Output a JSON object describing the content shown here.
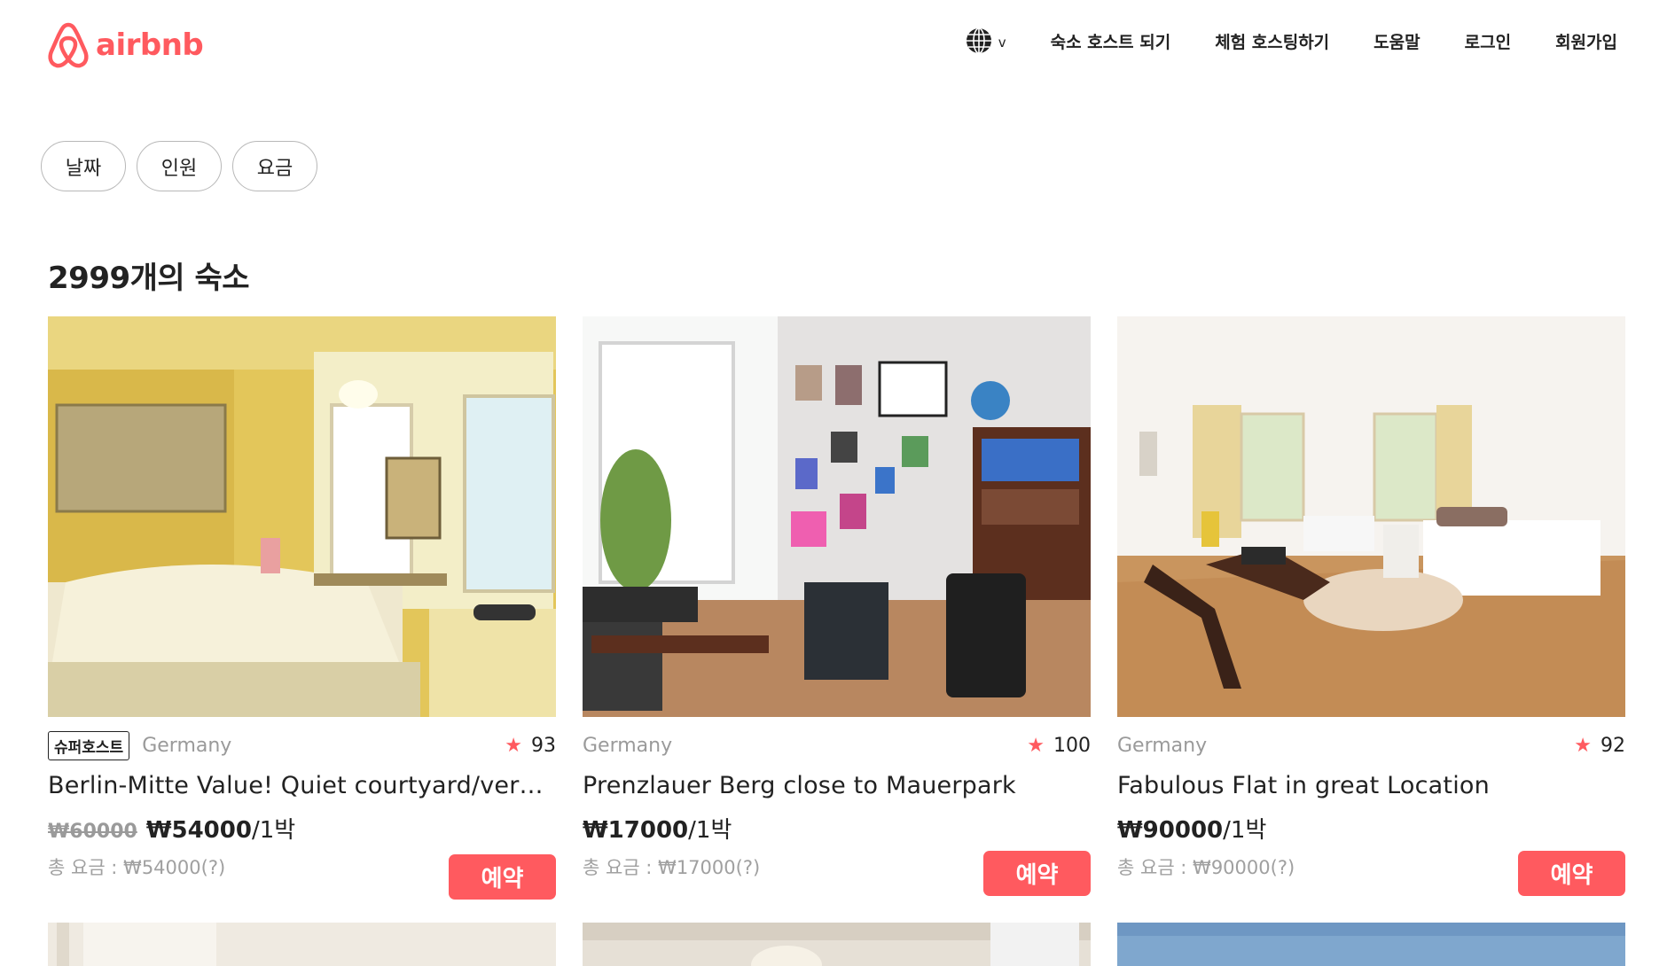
{
  "brand": {
    "name": "airbnb",
    "color": "#FF5A5F",
    "logo_icon": "airbnb-belo-icon"
  },
  "header": {
    "language_icon": "globe-icon",
    "language_caret": "v",
    "nav": [
      "숙소 호스트 되기",
      "체험 호스팅하기",
      "도움말",
      "로그인",
      "회원가입"
    ]
  },
  "filters": [
    "날짜",
    "인원",
    "요금"
  ],
  "results": {
    "title": "2999개의 숙소"
  },
  "listings": [
    {
      "superhost": "슈퍼호스트",
      "country": "Germany",
      "rating": "93",
      "name": "Berlin-Mitte Value! Quiet courtyard/very central",
      "old_price": "₩60000",
      "price": "₩54000",
      "per": "/1박",
      "total": "총 요금 : ₩54000(?)",
      "book": "예약"
    },
    {
      "superhost": "",
      "country": "Germany",
      "rating": "100",
      "name": "Prenzlauer Berg close to Mauerpark",
      "old_price": "",
      "price": "₩17000",
      "per": "/1박",
      "total": "총 요금 : ₩17000(?)",
      "book": "예약"
    },
    {
      "superhost": "",
      "country": "Germany",
      "rating": "92",
      "name": "Fabulous Flat in great Location",
      "old_price": "",
      "price": "₩90000",
      "per": "/1박",
      "total": "총 요금 : ₩90000(?)",
      "book": "예약"
    }
  ]
}
